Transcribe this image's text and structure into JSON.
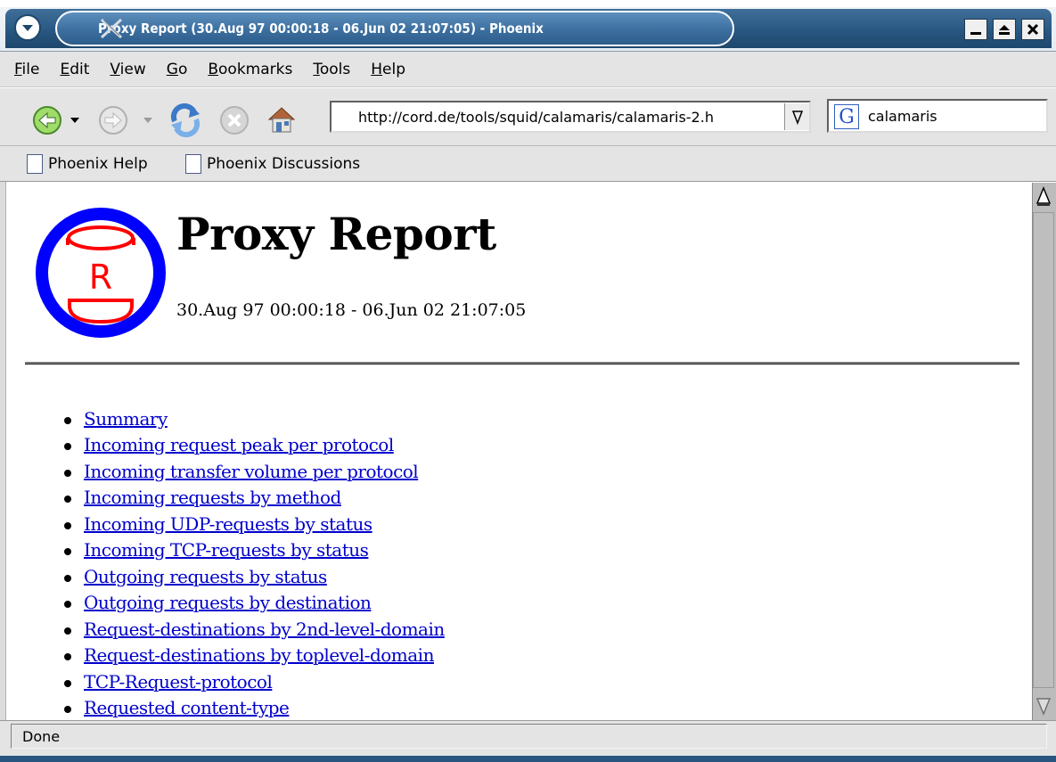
{
  "window": {
    "title": "Proxy Report (30.Aug 97 00:00:18 - 06.Jun 02 21:07:05) - Phoenix",
    "buttons": [
      "minimize",
      "maximize",
      "close"
    ]
  },
  "menubar": {
    "items": [
      {
        "label": "File",
        "key": "F"
      },
      {
        "label": "Edit",
        "key": "E"
      },
      {
        "label": "View",
        "key": "V"
      },
      {
        "label": "Go",
        "key": "G"
      },
      {
        "label": "Bookmarks",
        "key": "B"
      },
      {
        "label": "Tools",
        "key": "T"
      },
      {
        "label": "Help",
        "key": "H"
      }
    ]
  },
  "navbar": {
    "icons": [
      "back-icon",
      "forward-icon",
      "reload-icon",
      "stop-icon",
      "home-icon"
    ],
    "url": "http://cord.de/tools/squid/calamaris/calamaris-2.h",
    "search_value": "calamaris",
    "search_engine_letter": "G"
  },
  "bookmarks": {
    "items": [
      "Phoenix Help",
      "Phoenix Discussions"
    ]
  },
  "page": {
    "logo_letters": "R",
    "title": "Proxy Report",
    "subtitle": "30.Aug 97 00:00:18 - 06.Jun 02 21:07:05",
    "toc": [
      "Summary",
      "Incoming request peak per protocol",
      "Incoming transfer volume per protocol",
      "Incoming requests by method",
      "Incoming UDP-requests by status",
      "Incoming TCP-requests by status",
      "Outgoing requests by status",
      "Outgoing requests by destination",
      "Request-destinations by 2nd-level-domain",
      "Request-destinations by toplevel-domain",
      "TCP-Request-protocol",
      "Requested content-type"
    ]
  },
  "status": {
    "text": "Done"
  },
  "colors": {
    "titlebar": "#27557f",
    "link": "#0000cc",
    "logo_ring": "#0000ff",
    "logo_red": "#ff0000"
  }
}
